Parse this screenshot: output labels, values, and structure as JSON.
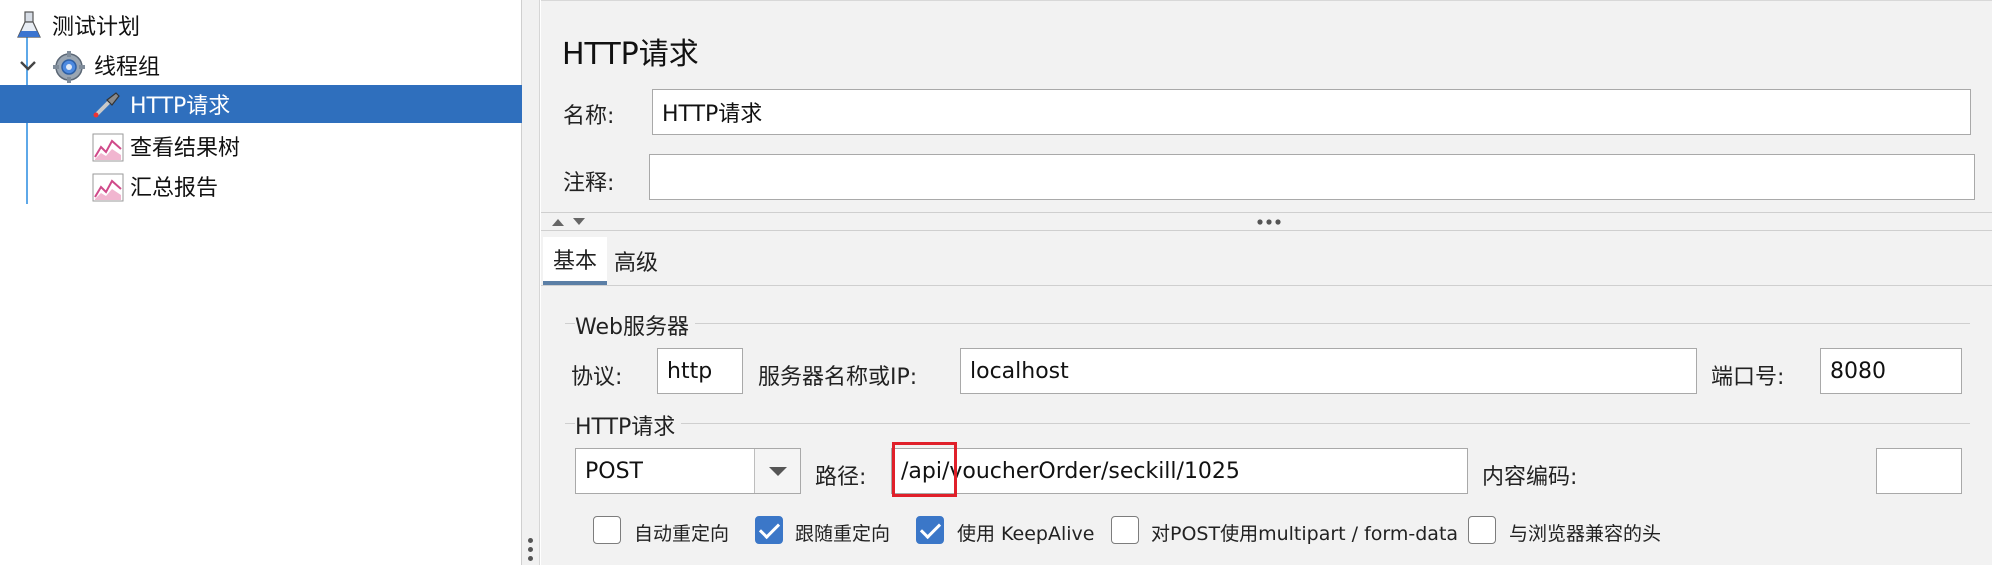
{
  "tree": {
    "items": [
      {
        "label": "测试计划",
        "icon": "flask-icon"
      },
      {
        "label": "线程组",
        "icon": "gear-icon",
        "expanded": true
      },
      {
        "label": "HTTP请求",
        "icon": "pipette-icon",
        "selected": true
      },
      {
        "label": "查看结果树",
        "icon": "graph-icon"
      },
      {
        "label": "汇总报告",
        "icon": "graph-icon"
      }
    ]
  },
  "panel": {
    "title": "HTTP请求",
    "name_label": "名称:",
    "name_value": "HTTP请求",
    "comment_label": "注释:",
    "comment_value": "",
    "tabs": [
      {
        "label": "基本",
        "active": true
      },
      {
        "label": "高级",
        "active": false
      }
    ],
    "web_server": {
      "group_title": "Web服务器",
      "protocol_label": "协议:",
      "protocol_value": "http",
      "server_label": "服务器名称或IP:",
      "server_value": "localhost",
      "port_label": "端口号:",
      "port_value": "8080"
    },
    "http_request": {
      "group_title": "HTTP请求",
      "method_value": "POST",
      "path_label": "路径:",
      "path_value": "/api/voucherOrder/seckill/1025",
      "encoding_label": "内容编码:",
      "encoding_value": ""
    },
    "checkboxes": [
      {
        "label": "自动重定向",
        "checked": false
      },
      {
        "label": "跟随重定向",
        "checked": true
      },
      {
        "label": "使用 KeepAlive",
        "checked": true
      },
      {
        "label": "对POST使用multipart / form-data",
        "checked": false
      },
      {
        "label": "与浏览器兼容的头",
        "checked": false
      }
    ]
  },
  "colors": {
    "selection": "#2f6fbd",
    "tree_line": "#5ea8e8",
    "checkbox_checked": "#3b77c8",
    "highlight_box": "#e0202a"
  }
}
